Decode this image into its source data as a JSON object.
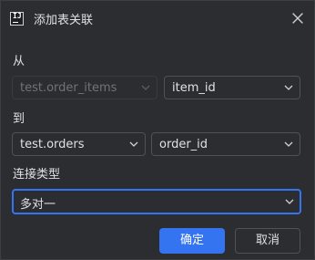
{
  "dialog": {
    "title": "添加表关联",
    "app_icon_text": "IJ"
  },
  "from": {
    "label": "从",
    "table": "test.order_items",
    "column": "item_id"
  },
  "to": {
    "label": "到",
    "table": "test.orders",
    "column": "order_id"
  },
  "join_type": {
    "label": "连接类型",
    "value": "多对一"
  },
  "buttons": {
    "ok": "确定",
    "cancel": "取消"
  },
  "colors": {
    "accent": "#3574f0",
    "background": "#2b2d30",
    "border": "#4e5157",
    "text": "#dfe1e5",
    "disabled_text": "#6f737a"
  }
}
